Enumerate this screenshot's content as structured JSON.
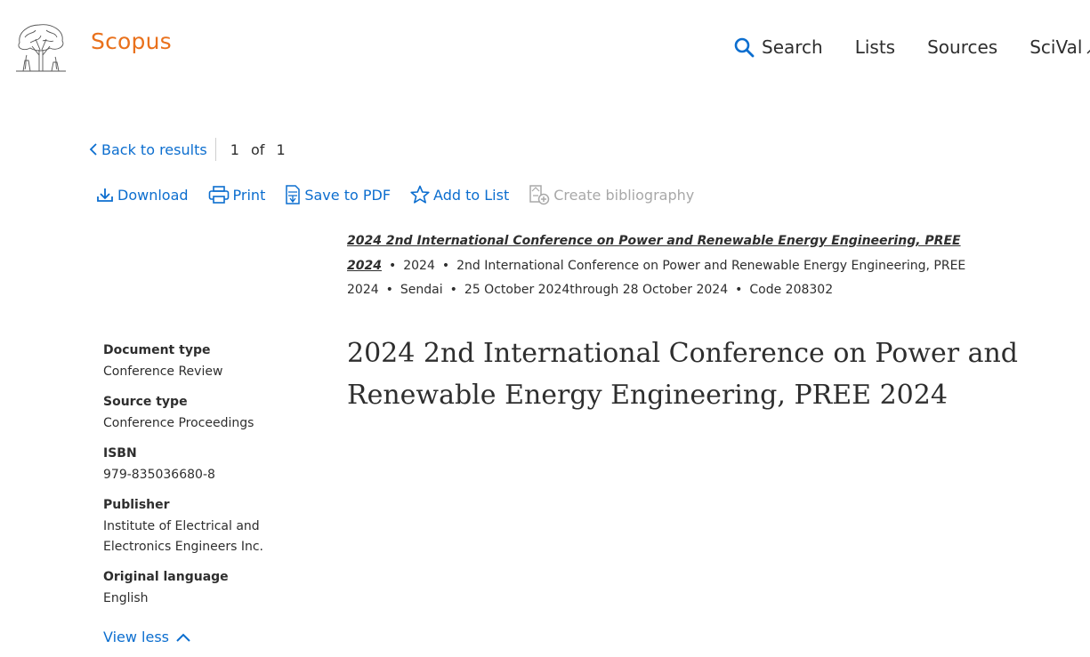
{
  "header": {
    "brand": "Scopus",
    "logo_icon": "elsevier-tree-logo",
    "nav": {
      "search": "Search",
      "lists": "Lists",
      "sources": "Sources",
      "scival": "SciVal"
    }
  },
  "navigation": {
    "back_label": "Back to results",
    "current": "1",
    "of_label": "of",
    "total": "1"
  },
  "toolbar": {
    "download": "Download",
    "print": "Print",
    "save_pdf": "Save to PDF",
    "add_list": "Add to List",
    "create_bibliography": "Create bibliography"
  },
  "source": {
    "link": "2024 2nd International Conference on Power and Renewable Energy Engineering, PREE 2024",
    "year": "2024",
    "conference": "2nd International Conference on Power and Renewable Energy Engineering, PREE 2024",
    "location": "Sendai",
    "dates": "25 October 2024through 28 October 2024",
    "code": "Code 208302",
    "separator": "•"
  },
  "document": {
    "title": "2024 2nd International Conference on Power and Renewable Energy Engineering, PREE 2024"
  },
  "metadata": {
    "document_type_label": "Document type",
    "document_type": "Conference Review",
    "source_type_label": "Source type",
    "source_type": "Conference Proceedings",
    "isbn_label": "ISBN",
    "isbn": "979-835036680-8",
    "publisher_label": "Publisher",
    "publisher": "Institute of Electrical and Electronics Engineers Inc.",
    "language_label": "Original language",
    "language": "English",
    "view_less": "View less"
  },
  "colors": {
    "accent": "#0c6ecf",
    "brand": "#e9711c",
    "text": "#2e2e2e",
    "disabled": "#a8a8a8"
  }
}
